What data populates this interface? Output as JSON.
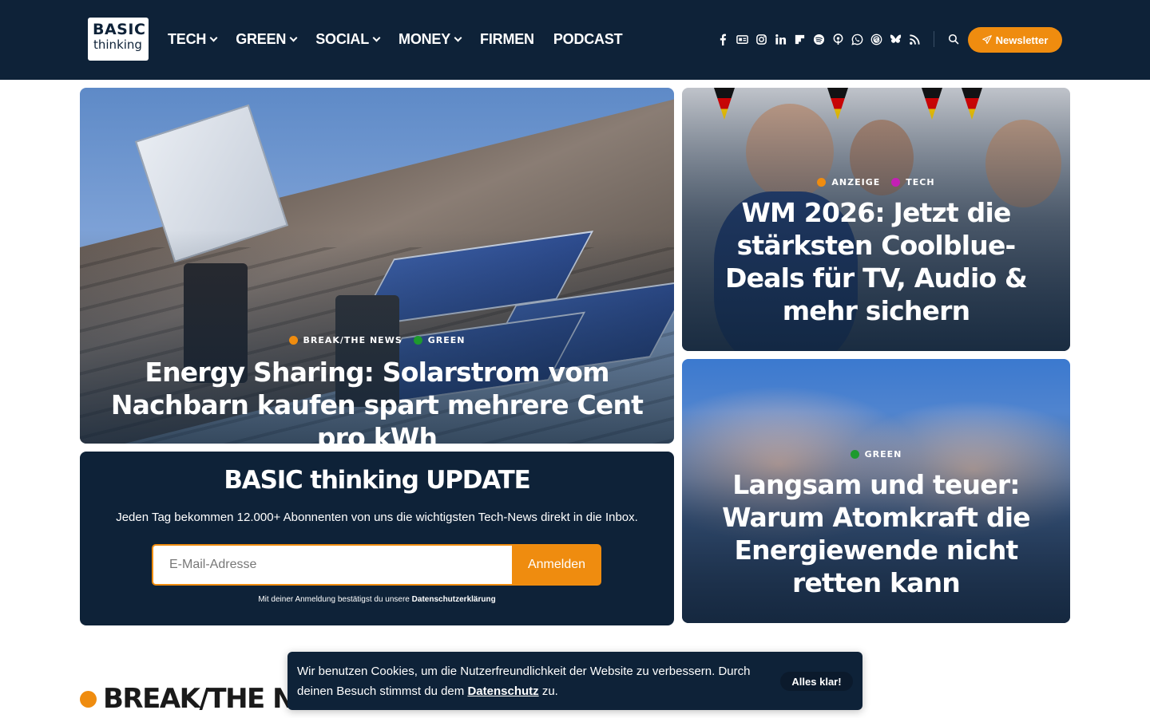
{
  "brand": {
    "line1": "BASIC",
    "line2": "thinking"
  },
  "nav": [
    {
      "label": "TECH",
      "dropdown": true
    },
    {
      "label": "GREEN",
      "dropdown": true
    },
    {
      "label": "SOCIAL",
      "dropdown": true
    },
    {
      "label": "MONEY",
      "dropdown": true
    },
    {
      "label": "FIRMEN",
      "dropdown": false
    },
    {
      "label": "PODCAST",
      "dropdown": false
    }
  ],
  "socials": [
    "facebook-icon",
    "xing-icon",
    "instagram-icon",
    "linkedin-icon",
    "flipboard-icon",
    "spotify-icon",
    "podcast-icon",
    "whatsapp-icon",
    "threads-icon",
    "bluesky-icon",
    "rss-icon"
  ],
  "header": {
    "newsletter_label": "Newsletter"
  },
  "cards": [
    {
      "tags": [
        {
          "label": "BREAK/THE NEWS",
          "color": "#ef8c0f"
        },
        {
          "label": "GREEN",
          "color": "#1e9a2e"
        }
      ],
      "title": "Energy Sharing: Solarstrom vom Nachbarn kaufen spart mehrere Cent pro kWh"
    },
    {
      "tags": [
        {
          "label": "ANZEIGE",
          "color": "#ef8c0f"
        },
        {
          "label": "TECH",
          "color": "#c41fb5"
        }
      ],
      "title": "WM 2026: Jetzt die stärksten Coolblue-Deals für TV, Audio & mehr sichern"
    },
    {
      "tags": [
        {
          "label": "GREEN",
          "color": "#1e9a2e"
        }
      ],
      "title": "Langsam und teuer: Warum Atomkraft die Energiewende nicht retten kann"
    }
  ],
  "newsletter_box": {
    "title": "BASIC thinking UPDATE",
    "subtitle": "Jeden Tag bekommen 12.000+ Abonnenten von uns die wichtigsten Tech-News direkt in die Inbox.",
    "input_placeholder": "E-Mail-Adresse",
    "button": "Anmelden",
    "legal_prefix": "Mit deiner Anmeldung bestätigst du unsere",
    "legal_link": "Datenschutzerklärung"
  },
  "section": {
    "title": "BREAK/THE NEWS",
    "color": "#ef8c0f"
  },
  "cookie": {
    "text_prefix": "Wir benutzen Cookies, um die Nutzerfreundlichkeit der Website zu verbessern. Durch deinen Besuch stimmst du dem",
    "link": "Datenschutz",
    "text_suffix": "zu.",
    "button": "Alles klar!"
  },
  "colors": {
    "navy": "#0e2238",
    "accent": "#ef8c0f"
  }
}
